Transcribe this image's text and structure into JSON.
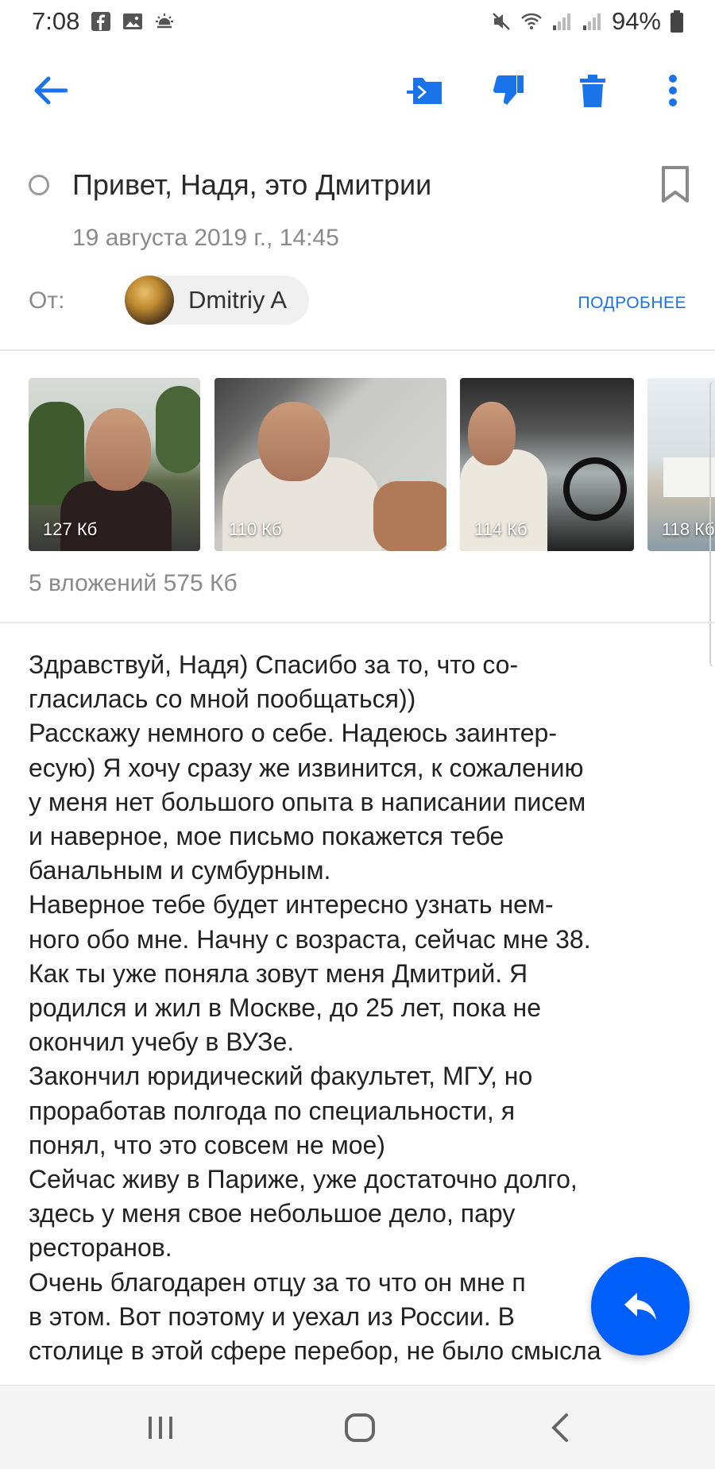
{
  "status_bar": {
    "time": "7:08",
    "battery": "94%"
  },
  "toolbar": {
    "back": "back-arrow-icon",
    "move": "move-to-folder-icon",
    "spam": "thumbs-down-icon",
    "delete": "trash-icon",
    "more": "more-vert-icon"
  },
  "email": {
    "subject": "Привет, Надя, это Дмитрии",
    "date": "19 августа 2019 г., 14:45",
    "from_label": "От:",
    "sender_name": "Dmitriy A",
    "details_link": "ПОДРОБНЕЕ"
  },
  "attachments": {
    "items": [
      {
        "size": "127  Кб"
      },
      {
        "size": "110  Кб"
      },
      {
        "size": "114  Кб"
      },
      {
        "size": "118  Кб"
      }
    ],
    "summary": "5 вложений 575  Кб"
  },
  "body": {
    "lines": [
      "Здравствуй, Надя) Спасибо за то, что со-",
      "гласилась со мной пообщаться))",
      "Расскажу немного о себе. Надеюсь заинтер-",
      "есую) Я хочу сразу же извинится, к сожалению",
      "у меня нет большого опыта в написании писем",
      "и наверное, мое письмо покажется тебе",
      "банальным и сумбурным.",
      "Наверное тебе будет интересно узнать нем-",
      "ного обо мне. Начну с возраста, сейчас мне 38.",
      "Как ты уже поняла зовут меня Дмитрий. Я",
      "родился и жил в Москве, до 25 лет, пока не",
      "окончил учебу в ВУЗе.",
      "Закончил юридический факультет, МГУ, но",
      "проработав полгода по специальности, я",
      "понял, что это совсем не мое)",
      "Сейчас живу в Париже, уже достаточно долго,",
      "здесь у меня свое небольшое дело, пару",
      "ресторанов.",
      "Очень благодарен отцу за то что он мне п",
      "в этом. Вот поэтому и уехал из России. В",
      "столице в этой сфере перебор, не было смысла"
    ]
  },
  "fab": {
    "icon": "reply-icon"
  },
  "navbar": {
    "recent": "recent-apps-icon",
    "home": "home-icon",
    "back": "nav-back-icon"
  }
}
